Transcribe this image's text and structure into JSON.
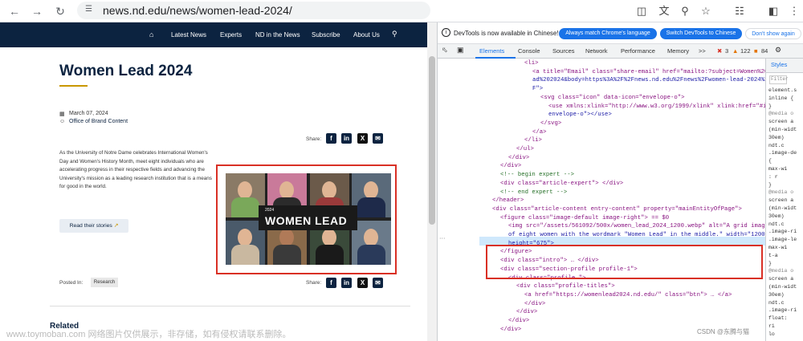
{
  "browser": {
    "url": "news.nd.edu/news/women-lead-2024/"
  },
  "site": {
    "nav": [
      "Latest News",
      "Experts",
      "ND in the News",
      "Subscribe",
      "About Us"
    ],
    "title": "Women Lead 2024",
    "date": "March 07, 2024",
    "author": "Office of Brand Content",
    "share_label": "Share:",
    "intro": "As the University of Notre Dame celebrates International Women's Day and Women's History Month, meet eight individuals who are accelerating progress in their respective fields and advancing the University's mission as a leading research institution that is a means for good in the world.",
    "read_button": "Read their stories",
    "figure": {
      "year": "2024",
      "wordmark": "WOMEN LEAD"
    },
    "posted_in_label": "Posted In:",
    "tag": "Research",
    "related": "Related"
  },
  "devtools": {
    "banner": "DevTools is now available in Chinese!",
    "btn_match": "Always match Chrome's language",
    "btn_switch": "Switch DevTools to Chinese",
    "btn_dont": "Don't show again",
    "tabs": [
      "Elements",
      "Console",
      "Sources",
      "Network",
      "Performance",
      "Memory",
      ">>"
    ],
    "badges": {
      "errors": "3",
      "warnings": "122",
      "info": "84"
    },
    "styles_tab": "Styles",
    "filter_placeholder": "Filter",
    "lines": [
      {
        "indent": 2,
        "text": "<li>"
      },
      {
        "indent": 3,
        "text": "<a title=\"Email\" class=\"share-email\" href=\"mailto:?subject=Women%20Le"
      },
      {
        "indent": 3,
        "text": "ad%202024&body=https%3A%2F%2Fnews.nd.edu%2Fnews%2Fwomen-lead-2024%2"
      },
      {
        "indent": 3,
        "text": "F\">"
      },
      {
        "indent": 4,
        "text": "<svg class=\"icon\" data-icon=\"envelope-o\">"
      },
      {
        "indent": 5,
        "text": "<use xmlns:xlink=\"http://www.w3.org/1999/xlink\" xlink:href=\"#icon-"
      },
      {
        "indent": 5,
        "text": "envelope-o\"></use>"
      },
      {
        "indent": 4,
        "text": "</svg>"
      },
      {
        "indent": 3,
        "text": "</a>"
      },
      {
        "indent": 2,
        "text": "</li>"
      },
      {
        "indent": 1,
        "text": "</ul>"
      },
      {
        "indent": 0,
        "text": "</div>"
      },
      {
        "indent": -1,
        "text": "</div>"
      },
      {
        "indent": -1,
        "text": "<!-- begin expert -->"
      },
      {
        "indent": -1,
        "text": "<div class=\"article-expert\"> </div>"
      },
      {
        "indent": -1,
        "text": "<!-- end expert -->"
      },
      {
        "indent": -2,
        "text": "</header>"
      },
      {
        "indent": -2,
        "text": "<div class=\"article-content entry-content\" property=\"mainEntityOfPage\">"
      },
      {
        "indent": -1,
        "text": "<figure class=\"image-default image-right\"> == $0"
      },
      {
        "indent": 0,
        "text": "<img src=\"/assets/561092/500x/women_lead_2024_1200.webp\" alt=\"A grid image"
      },
      {
        "indent": 0,
        "text": "of eight women with the wordmark \"Women Lead\" in the middle.\" width=\"1200\""
      },
      {
        "indent": 0,
        "text": "height=\"675\">"
      },
      {
        "indent": -1,
        "text": "</figure>"
      },
      {
        "indent": -1,
        "text": "<div class=\"intro\"> … </div>"
      },
      {
        "indent": -1,
        "text": "<div class=\"section-profile profile-1\">"
      },
      {
        "indent": 0,
        "text": "<div class=\"profile \">"
      },
      {
        "indent": 1,
        "text": "<div class=\"profile-titles\">"
      },
      {
        "indent": 2,
        "text": "<a href=\"https://womenlead2024.nd.edu/\" class=\"btn\"> … </a>"
      },
      {
        "indent": 2,
        "text": "</div>"
      },
      {
        "indent": 1,
        "text": "</div>"
      },
      {
        "indent": 0,
        "text": "</div>"
      },
      {
        "indent": -1,
        "text": "</div>"
      }
    ],
    "styles_lines": [
      "element.s",
      "inline {",
      "}",
      "@media o",
      "screen a",
      "(min-widt",
      "30em)",
      "ndt.c",
      ".image-de",
      "{",
      "max-wi",
      ": r",
      "}",
      "@media o",
      "screen a",
      "(min-widt",
      "30em)",
      "ndt.c",
      ".image-ri",
      ".image-le",
      "max-wi",
      "t-a",
      "}",
      "@media o",
      "screen a",
      "(min-widt",
      "30em)",
      "ndt.c",
      ".image-ri",
      "float:",
      "ri",
      "lo"
    ]
  },
  "overlays": {
    "watermark": "www.toymoban.com 网络图片仅供展示，非存储，如有侵权请联系删除。",
    "csdn": "CSDN @东腾与猫"
  }
}
